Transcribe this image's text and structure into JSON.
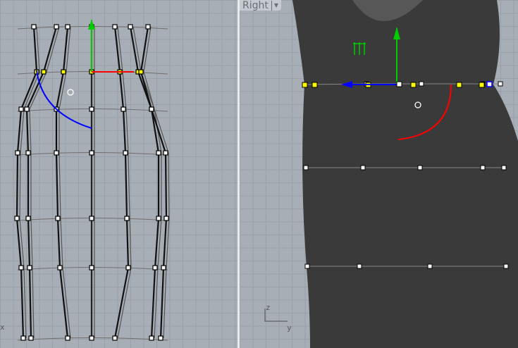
{
  "viewports": {
    "left": {
      "axis_x_label": "x"
    },
    "right": {
      "title": "Right",
      "dropdown_icon": "triangle-down",
      "axis_z_label": "z",
      "axis_y_label": "y"
    }
  },
  "colors": {
    "gizmo_x": "#ff0000",
    "gizmo_y": "#00cc00",
    "gizmo_z": "#0000ff",
    "selected_point": "#ffff00",
    "surface": "#3a3a3a"
  }
}
